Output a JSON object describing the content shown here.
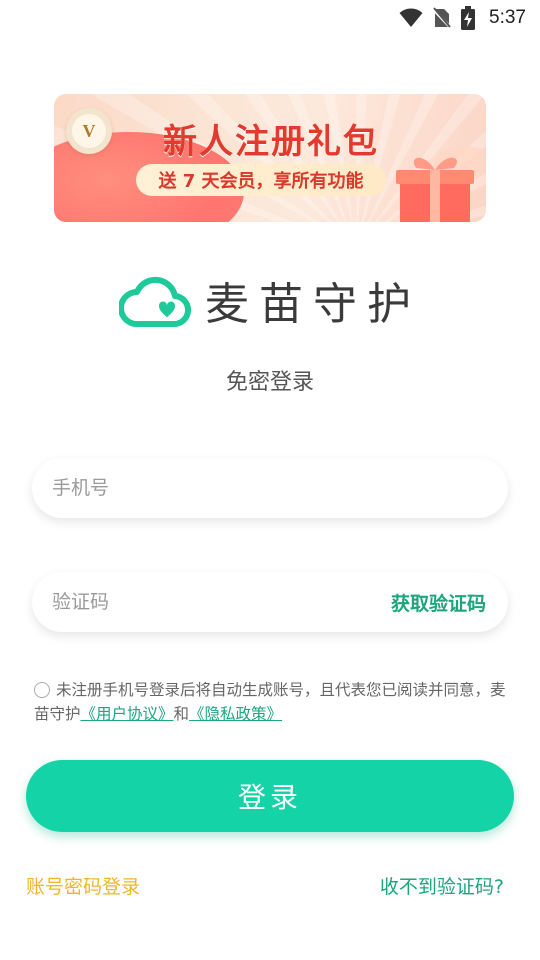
{
  "status_bar": {
    "time": "5:37",
    "icons": [
      "wifi-icon",
      "no-sim-icon",
      "battery-charging-icon"
    ]
  },
  "banner": {
    "badge_letter": "V",
    "title": "新人注册礼包",
    "subtitle": "送 7 天会员，享所有功能"
  },
  "brand": {
    "name": "麦苗守护",
    "logo_icon": "cloud-heart-icon",
    "logo_color": "#1ec99a"
  },
  "subtitle": "免密登录",
  "phone": {
    "placeholder": "手机号",
    "value": ""
  },
  "code": {
    "placeholder": "验证码",
    "value": "",
    "get_code_label": "获取验证码"
  },
  "agreement": {
    "text": "未注册手机号登录后将自动生成账号，且代表您已阅读并同意，麦苗守护",
    "user_agreement": "《用户协议》",
    "and": "和",
    "privacy_policy": "《隐私政策》",
    "checked": false
  },
  "login_button": "登录",
  "footer": {
    "password_login": "账号密码登录",
    "no_code": "收不到验证码?"
  },
  "colors": {
    "accent": "#14d3a6",
    "link": "#1ba67b",
    "secondary": "#f1b52a"
  }
}
